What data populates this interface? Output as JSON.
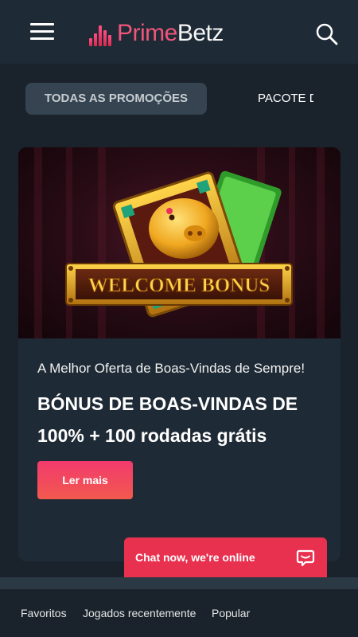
{
  "header": {
    "logo_part1": "Prime",
    "logo_part2": "Betz",
    "menu_icon": "hamburger-menu-icon",
    "search_icon": "search-icon",
    "brand_color": "#f0567a"
  },
  "tabs": [
    {
      "label": "TODAS AS PROMOÇÕES",
      "active": true
    },
    {
      "label": "PACOTE DE",
      "active": false
    }
  ],
  "promo": {
    "banner_text": "WELCOME BONUS",
    "subtitle": "A Melhor Oferta de Boas-Vindas de Sempre!",
    "title": "BÓNUS DE BOAS-VINDAS DE 100% + 100 rodadas grátis",
    "cta_label": "Ler mais",
    "cta_color": "#f23a6d"
  },
  "chat": {
    "label": "Chat now, we're online",
    "icon": "chat-bubble-icon",
    "color": "#e8304f"
  },
  "footer": {
    "links": [
      "Favoritos",
      "Jogados recentemente",
      "Popular"
    ]
  }
}
